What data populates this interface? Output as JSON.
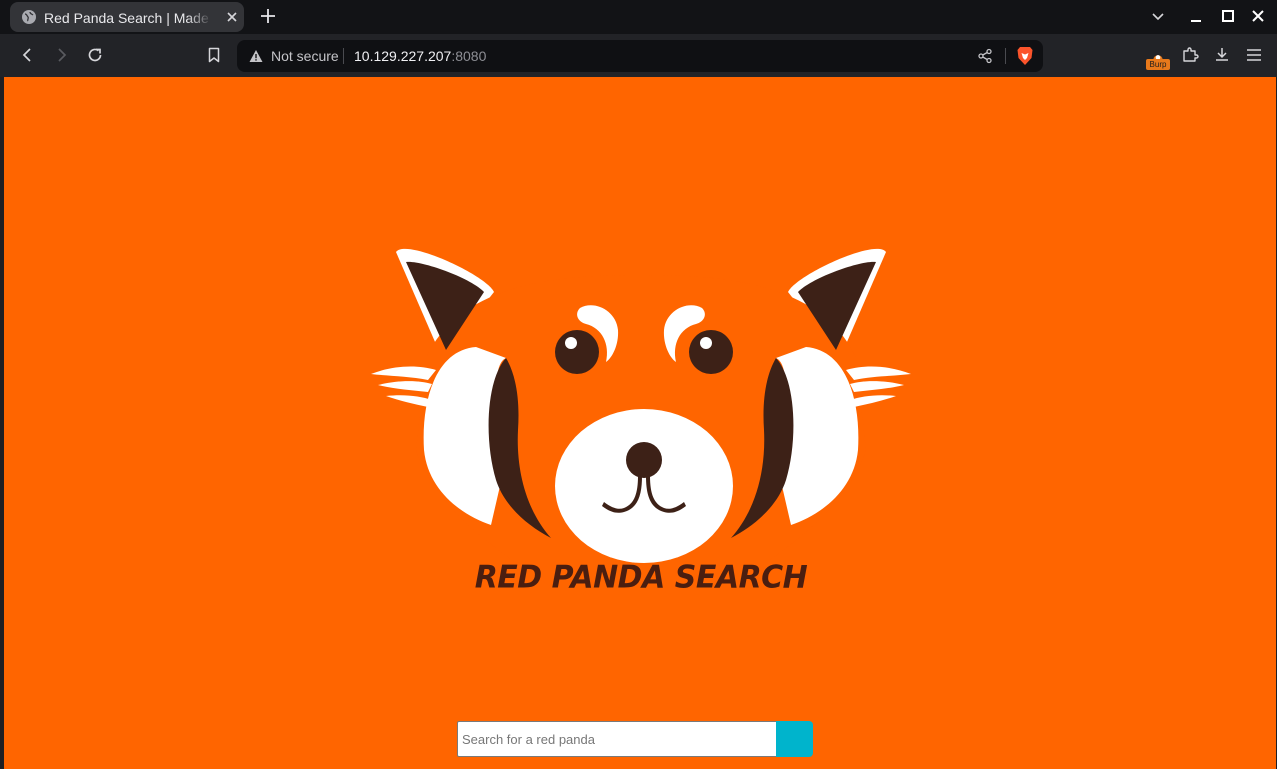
{
  "browser": {
    "tab": {
      "title": "Red Panda Search | Made with Spring Boot"
    },
    "address_bar": {
      "security_label": "Not secure",
      "host": "10.129.227.207",
      "port": ":8080"
    },
    "extensions": {
      "burp_label": "Burp"
    }
  },
  "page": {
    "brand_title": "RED PANDA SEARCH",
    "search": {
      "placeholder": "Search for a red panda",
      "value": ""
    },
    "colors": {
      "background": "#ff6500",
      "search_button": "#00b4cc",
      "panda_dark": "#3d2117",
      "panda_white": "#ffffff"
    }
  },
  "icons": {
    "tab_favicon": "globe-icon",
    "tab_close": "close-icon",
    "new_tab": "plus-icon",
    "back": "arrow-left-icon",
    "forward": "arrow-right-icon",
    "reload": "reload-icon",
    "bookmark": "bookmark-icon",
    "share": "share-icon",
    "brave_shield": "brave-lion-icon",
    "extensions": "puzzle-icon",
    "downloads": "download-icon",
    "menu": "hamburger-menu-icon"
  }
}
